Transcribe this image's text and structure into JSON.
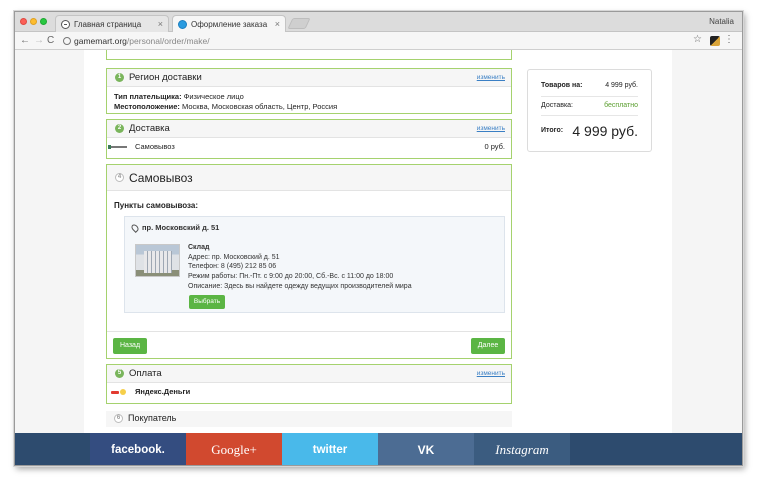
{
  "browser": {
    "tabs": [
      {
        "label": "Главная страница"
      },
      {
        "label": "Оформление заказа"
      }
    ],
    "tab_close": "×",
    "profile_name": "Natalia",
    "url_host": "gamemart.org",
    "url_path": "/personal/order/make/",
    "icons": {
      "back": "←",
      "forward": "→",
      "reload": "C",
      "star": "☆",
      "menu": "⋮"
    }
  },
  "order": {
    "region": {
      "step": "1",
      "title": "Регион доставки",
      "edit": "изменить",
      "payer_type_label": "Тип плательщика:",
      "payer_type_value": " Физическое лицо",
      "location_label": "Местоположение:",
      "location_value": " Москва, Московская область, Центр, Россия"
    },
    "delivery": {
      "step": "2",
      "title": "Доставка",
      "edit": "изменить",
      "method": "Самовывоз",
      "price": "0 руб."
    },
    "pickup": {
      "step": "4",
      "title": "Самовывоз",
      "points_title": "Пункты самовывоза:",
      "point": {
        "address_title": "пр. Московский д. 51",
        "name": "Склад",
        "address": "Адрес: пр. Московский д. 51",
        "phone": "Телефон: 8 (495) 212 85 06",
        "hours": "Режим работы: Пн.-Пт. с 9:00 до 20:00, Сб.-Вс. с 11:00 до 18:00",
        "description": "Описание: Здесь вы найдете одежду ведущих производителей мира",
        "select_label": "Выбрать"
      },
      "back_label": "Назад",
      "next_label": "Далее"
    },
    "payment": {
      "step": "5",
      "title": "Оплата",
      "edit": "изменить",
      "method": "Яндекс.Деньги"
    },
    "buyer": {
      "step": "6",
      "title": "Покупатель"
    }
  },
  "summary": {
    "goods_label": "Товаров на:",
    "goods_value": "4 999 руб.",
    "delivery_label": "Доставка:",
    "delivery_value": "бесплатно",
    "total_label": "Итого:",
    "total_value": "4 999 руб."
  },
  "social": [
    {
      "label": "facebook."
    },
    {
      "label": "Google+"
    },
    {
      "label": "twitter"
    },
    {
      "label": "VK"
    },
    {
      "label": "Instagram"
    }
  ],
  "colors": {
    "accent_green": "#5bb544",
    "block_border": "#a5d26e",
    "link_blue": "#3a7fc4",
    "facebook": "#344d80",
    "google": "#d1492f",
    "twitter": "#49b9ea",
    "vk": "#4c6c93",
    "instagram": "#3b5c80"
  }
}
